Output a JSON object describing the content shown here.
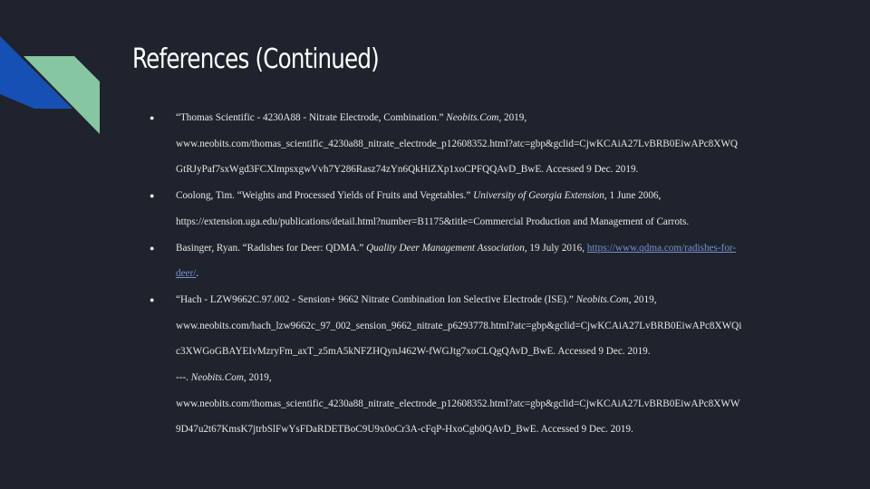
{
  "slide": {
    "title": "References (Continued)",
    "colors": {
      "background": "#1e232d",
      "accent_blue": "#1650b4",
      "accent_green": "#86c6a0",
      "text": "#e8e8e8",
      "link": "#7b8fd0"
    },
    "bullet_glyph": "●"
  },
  "references": [
    {
      "line1_prefix": "“Thomas Scientific - 4230A88 - Nitrate Electrode, Combination.”",
      "line1_pub": "Neobits.Com",
      "line1_suffix": ", 2019,",
      "line2": "www.neobits.com/thomas_scientific_4230a88_nitrate_electrode_p12608352.html?atc=gbp&gclid=CjwKCAiA27LvBRB0EiwAPc8XWQ",
      "line3": "GtRJyPaf7sxWgd3FCXlmpsxgwVvh7Y286Rasz74zYn6QkHiZXp1xoCPFQQAvD_BwE. Accessed 9 Dec. 2019."
    },
    {
      "line1_prefix": "Coolong, Tim. “Weights and Processed Yields of Fruits and Vegetables.”",
      "line1_pub": "University of Georgia Extension",
      "line1_suffix": ", 1 June 2006,",
      "line2": "https://extension.uga.edu/publications/detail.html?number=B1175&title=Commercial  Production and Management of Carrots."
    },
    {
      "line1_prefix": "Basinger, Ryan. “Radishes for Deer: QDMA.”",
      "line1_pub": "Quality Deer Management Association",
      "line1_suffix": ", 19 July 2016,",
      "link_part1": "https://www.qdma.com/radishes-for-",
      "link_part2": "deer/",
      "line2_suffix": "."
    },
    {
      "line1_prefix": "“Hach - LZW9662C.97.002 - Sension+ 9662 Nitrate Combination Ion Selective Electrode (ISE).”",
      "line1_pub": "Neobits.Com",
      "line1_suffix": ", 2019,",
      "line2": "www.neobits.com/hach_lzw9662c_97_002_sension_9662_nitrate_p6293778.html?atc=gbp&gclid=CjwKCAiA27LvBRB0EiwAPc8XWQi",
      "line3": "c3XWGoGBAYEIvMzryFm_axT_z5mA5kNFZHQynJ462W-fWGJtg7xoCLQgQAvD_BwE. Accessed 9 Dec. 2019.",
      "line4_prefix": "---.",
      "line4_pub": "Neobits.Com",
      "line4_suffix": ", 2019,",
      "line5": "www.neobits.com/thomas_scientific_4230a88_nitrate_electrode_p12608352.html?atc=gbp&gclid=CjwKCAiA27LvBRB0EiwAPc8XWW",
      "line6": "9D47u2t67KmsK7jtrbSlFwYsFDaRDETBoC9U9x0oCr3A-cFqP-HxoCgb0QAvD_BwE. Accessed 9 Dec. 2019."
    }
  ]
}
